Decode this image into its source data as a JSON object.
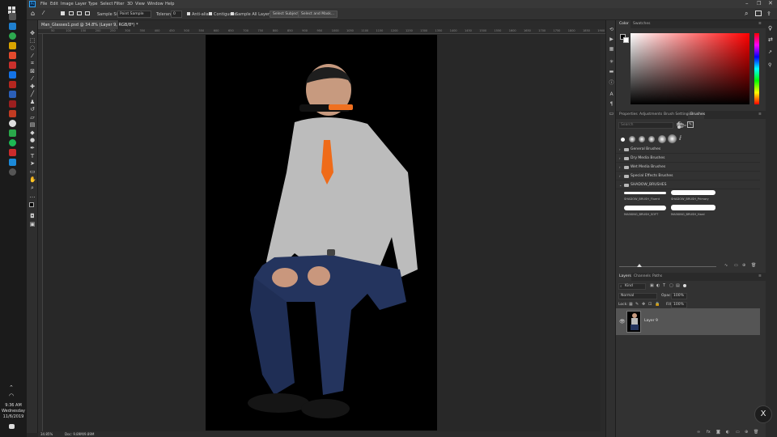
{
  "taskbar": {
    "time": "9:36 AM",
    "day": "Wednesday",
    "date": "11/6/2019"
  },
  "menu": {
    "items": [
      "File",
      "Edit",
      "Image",
      "Layer",
      "Type",
      "Select",
      "Filter",
      "3D",
      "View",
      "Window",
      "Help"
    ]
  },
  "options": {
    "sample_size_label": "Sample Size:",
    "sample_size_value": "Point Sample",
    "tolerance_label": "Tolerance:",
    "tolerance_value": "0",
    "anti_alias": "Anti-alias",
    "contiguous": "Contiguous",
    "sample_all_layers": "Sample All Layers",
    "select_subject": "Select Subject",
    "select_and_mask": "Select and Mask..."
  },
  "document": {
    "tab_title": "Man_Glasses1.psd @ 34.8% (Layer 9, RGB/8*) *",
    "zoom": "34.85%",
    "doc_size": "Doc: 9.89M/9.89M"
  },
  "ruler": {
    "ticks": [
      "50",
      "100",
      "150",
      "200",
      "250",
      "300",
      "350",
      "400",
      "450",
      "500",
      "550",
      "600",
      "650",
      "700",
      "750",
      "800",
      "850",
      "900",
      "950",
      "1000",
      "1050",
      "1100",
      "1150",
      "1200",
      "1250",
      "1300",
      "1350",
      "1400",
      "1450",
      "1500",
      "1550",
      "1600",
      "1650",
      "1700",
      "1750",
      "1800",
      "1850",
      "1900",
      "1950"
    ]
  },
  "color_panel": {
    "tabs": [
      "Color",
      "Swatches"
    ]
  },
  "brushes_panel": {
    "tabs": [
      "Properties",
      "Adjustments",
      "Brush Settings",
      "Brushes"
    ],
    "search_placeholder": "Search",
    "folders": [
      "General Brushes",
      "Dry Media Brushes",
      "Wet Media Brushes",
      "Special Effects Brushes",
      "SHADOW_BRUSHES"
    ],
    "brushes": [
      "SHADOW_BRUSH_Fluent",
      "SHADOW_BRUSH_Primary",
      "MASKING_BRUSH_SOFT",
      "MASKING_BRUSH_Hard"
    ]
  },
  "layers_panel": {
    "tabs": [
      "Layers",
      "Channels",
      "Paths"
    ],
    "kind_label": "Kind",
    "blend_mode": "Normal",
    "opacity_label": "Opacity:",
    "opacity_value": "100%",
    "lock_label": "Lock:",
    "fill_label": "Fill:",
    "fill_value": "100%",
    "layers": [
      {
        "name": "Layer 9"
      }
    ]
  },
  "colors": {
    "accent": "#1473e6",
    "canvas_bg": "#000000"
  }
}
